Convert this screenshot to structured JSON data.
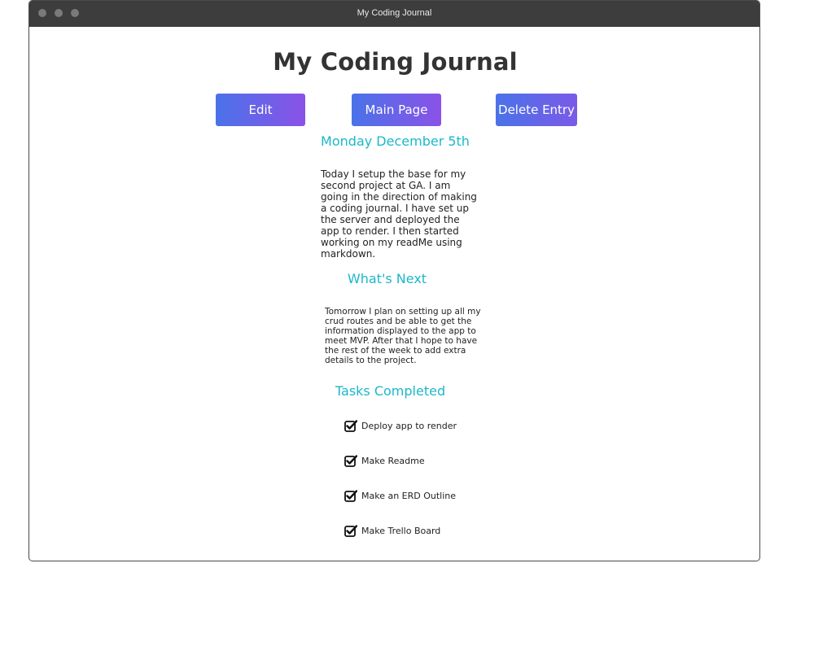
{
  "window": {
    "title": "My Coding Journal"
  },
  "page": {
    "title": "My Coding Journal"
  },
  "toolbar": {
    "edit_label": "Edit",
    "main_page_label": "Main Page",
    "delete_label": "Delete Entry"
  },
  "entry": {
    "date": "Monday December 5th",
    "body": "Today I setup the base for my second project at GA. I am going in the direction of making a coding journal.  I have set up the server and deployed the app to render. I then started working on my readMe using markdown."
  },
  "next": {
    "heading": "What's Next",
    "body": "Tomorrow I plan on setting up all my crud routes and be able to get the information displayed to the app to meet MVP. After that I hope to have the rest of the week to add extra details to the project."
  },
  "tasks": {
    "heading": "Tasks Completed",
    "items": [
      {
        "label": "Deploy app to render",
        "icon": "checkbox-checked-icon"
      },
      {
        "label": "Make Readme",
        "icon": "checkbox-checked-icon"
      },
      {
        "label": "Make an ERD Outline",
        "icon": "checkbox-checked-icon"
      },
      {
        "label": "Make Trello Board",
        "icon": "checkbox-checked-icon"
      }
    ]
  },
  "colors": {
    "accent": "#1bb8c8",
    "button_gradient_start": "#4a72e8",
    "button_gradient_end": "#8b52e8",
    "titlebar": "#3d3d3d"
  }
}
